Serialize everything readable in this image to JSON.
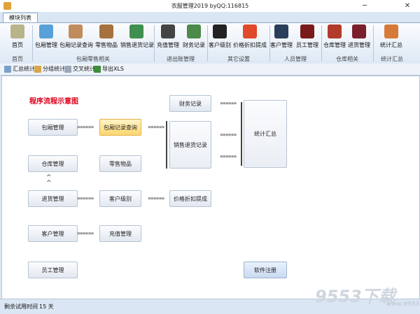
{
  "window": {
    "title": "衣服管理2019 byQQ:116815",
    "minimize": "─",
    "close": "✕"
  },
  "tabs": [
    {
      "label": "模块列表"
    }
  ],
  "ribbon": {
    "buttons": [
      {
        "label": "首页",
        "icon": "home-icon",
        "color": "#b8b48a"
      },
      {
        "label": "包厢管理",
        "icon": "cubes-icon",
        "color": "#5aa0d8"
      },
      {
        "label": "包厢记录查询",
        "icon": "register-icon",
        "color": "#c08c5c"
      },
      {
        "label": "零售物品",
        "icon": "books-icon",
        "color": "#a6713e"
      },
      {
        "label": "销售退货记录",
        "icon": "chart-icon",
        "color": "#3f8f4e"
      },
      {
        "label": "充值管理",
        "icon": "gear-icon",
        "color": "#444444"
      },
      {
        "label": "财务记录",
        "icon": "money-icon",
        "color": "#4c8a4c"
      },
      {
        "label": "客户级别",
        "icon": "badge-icon",
        "color": "#222222"
      },
      {
        "label": "价格折扣提成",
        "icon": "percent-icon",
        "color": "#e04a2a"
      },
      {
        "label": "客户管理",
        "icon": "customer-icon",
        "color": "#2a3d5a"
      },
      {
        "label": "员工管理",
        "icon": "employee-icon",
        "color": "#7a1a1a"
      },
      {
        "label": "仓库管理",
        "icon": "warehouse-icon",
        "color": "#b23b2b"
      },
      {
        "label": "进货管理",
        "icon": "purchase-icon",
        "color": "#7b1f2c"
      },
      {
        "label": "统计汇总",
        "icon": "stats-icon",
        "color": "#d67a3a"
      }
    ],
    "groups": [
      "首页",
      "包厢零售相关",
      "进出账管理",
      "其它设置",
      "人员管理",
      "仓库相关",
      "统计汇总"
    ]
  },
  "toolbar": [
    {
      "label": "汇总统计",
      "icon": "summary-icon",
      "color": "#7aa0c8"
    },
    {
      "label": "分组统计",
      "icon": "group-icon",
      "color": "#d9a64a"
    },
    {
      "label": "交叉统计",
      "icon": "cross-icon",
      "color": "#9aa7b6"
    },
    {
      "label": "导出XLS",
      "icon": "export-icon",
      "color": "#3d8d3d"
    }
  ],
  "flow": {
    "title": "程序流程示意图",
    "arrow": "»»»»»»",
    "caret": "^",
    "boxes": {
      "baoxiang": "包厢管理",
      "baoxiang_query": "包厢记录查询",
      "caiwu": "财务记录",
      "xiaoshou": "销售退货记录",
      "tongji": "统计汇总",
      "cangku": "仓库管理",
      "lingshou": "零售物品",
      "jinhuo": "进货管理",
      "kehu_jibie": "客户级别",
      "jiage": "价格折扣提成",
      "kehu": "客户管理",
      "chongzhi": "充值管理",
      "yuangong": "员工管理",
      "zhuce": "软件注册"
    }
  },
  "status": {
    "label": "剩余试用时间",
    "value": "15  天"
  },
  "watermark": {
    "text": "9553下载",
    "sub": "www.9553.com"
  }
}
